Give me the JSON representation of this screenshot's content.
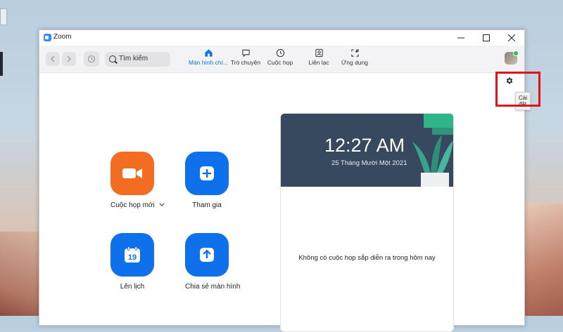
{
  "window": {
    "title": "Zoom"
  },
  "search": {
    "placeholder": "Tìm kiếm"
  },
  "tabs": [
    {
      "label": "Màn hình chí...",
      "icon": "home-icon"
    },
    {
      "label": "Trò chuyện",
      "icon": "chat-icon"
    },
    {
      "label": "Cuộc họp",
      "icon": "clock-icon"
    },
    {
      "label": "Liên lạc",
      "icon": "contacts-icon"
    },
    {
      "label": "Ứng dụng",
      "icon": "apps-icon"
    }
  ],
  "settings": {
    "tooltip": "Cài đặt"
  },
  "actions": {
    "new_meeting": "Cuộc họp mới",
    "join": "Tham gia",
    "schedule": "Lên lịch",
    "schedule_day": "19",
    "share_screen": "Chia sẻ màn hình"
  },
  "card": {
    "time": "12:27 AM",
    "date": "25 Tháng Mười Một 2021",
    "empty_text": "Không có cuộc họp sắp diễn ra trong hôm nay"
  },
  "colors": {
    "accent": "#0e71eb",
    "new_meeting": "#f26d21",
    "card_header": "#36495f",
    "highlight": "#e0121b"
  }
}
